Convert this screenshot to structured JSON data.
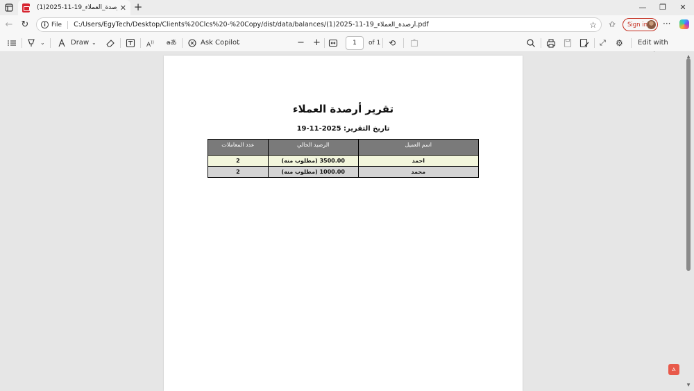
{
  "browser": {
    "tab_title": "أرصدة_العملاء_19-11-2025(1).pdf",
    "omnibox_scheme": "File",
    "url": "C:/Users/EgyTech/Desktop/Clients%20Clcs%20-%20Copy/dist/data/balances/أرصدة_العملاء_19-11-2025(1).pdf",
    "signin_label": "Sign in"
  },
  "pdf_toolbar": {
    "draw_label": "Draw",
    "ask_copilot_label": "Ask Copilot",
    "page_number": "1",
    "page_total": "of 1",
    "edit_acrobat_label": "Edit with Acrobat"
  },
  "document": {
    "title": "تقرير أرصدة العملاء",
    "date_line": "تاريخ التقرير: 2025-11-19",
    "table": {
      "headers": [
        "اسم العميل",
        "الرصيد الحالي",
        "عدد المعاملات"
      ],
      "rows": [
        [
          "احمد",
          "3500.00 (مطلوب منه)",
          "2"
        ],
        [
          "محمد",
          "1000.00 (مطلوب منه)",
          "2"
        ]
      ]
    }
  },
  "colors": {
    "header_bg": "#7a7a7a",
    "row_odd_bg": "#f3f6dc",
    "row_even_bg": "#d4d4d4",
    "signin_accent": "#c42b1c"
  }
}
